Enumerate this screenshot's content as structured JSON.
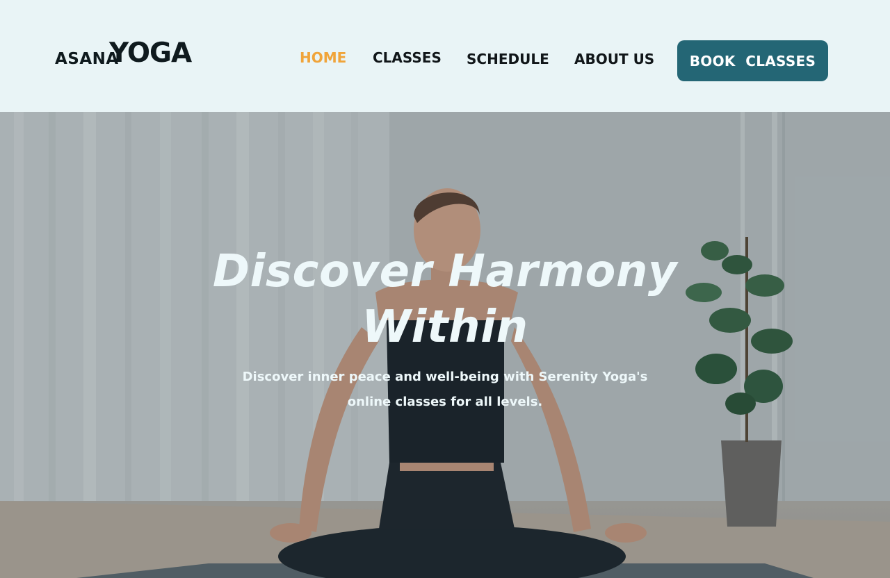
{
  "brand": {
    "small": "ASANA",
    "big": "YOGA"
  },
  "nav": {
    "items": [
      {
        "label": "HOME",
        "active": true
      },
      {
        "label": "CLASSES",
        "active": false
      },
      {
        "label": "SCHEDULE",
        "active": false
      },
      {
        "label": "ABOUT US",
        "active": false
      }
    ],
    "cta_label": "BOOK  CLASSES"
  },
  "hero": {
    "title": "Discover  Harmony Within",
    "subtitle": "Discover inner peace and well-being with Serenity Yoga's online classes for all levels."
  },
  "colors": {
    "header_bg": "#e9f4f6",
    "active_nav": "#f0a43a",
    "cta_bg": "#246675",
    "text_dark": "#111619",
    "hero_text": "#eef8fa"
  }
}
